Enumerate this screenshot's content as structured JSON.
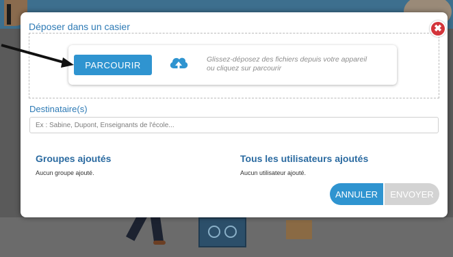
{
  "modal": {
    "title": "Déposer dans un casier",
    "close_icon": "close-icon",
    "close_glyph": "✖",
    "dropzone": {
      "browse_label": "PARCOURIR",
      "upload_icon": "cloud-upload-icon",
      "instructions_line1": "Glissez-déposez des fichiers depuis votre appareil",
      "instructions_line2": "ou cliquez sur parcourir"
    },
    "recipients": {
      "label": "Destinataire(s)",
      "placeholder": "Ex : Sabine, Dupont, Enseignants de l'école..."
    },
    "groups": {
      "title": "Groupes ajoutés",
      "empty_text": "Aucun groupe ajouté."
    },
    "users": {
      "title": "Tous les utilisateurs ajoutés",
      "empty_text": "Aucun utilisateur ajouté."
    },
    "actions": {
      "cancel_label": "ANNULER",
      "send_label": "ENVOYER"
    }
  },
  "colors": {
    "accent": "#2f94d0",
    "title_blue": "#2d7ab5",
    "close_red": "#d3343a",
    "disabled": "#d3d3d3"
  }
}
